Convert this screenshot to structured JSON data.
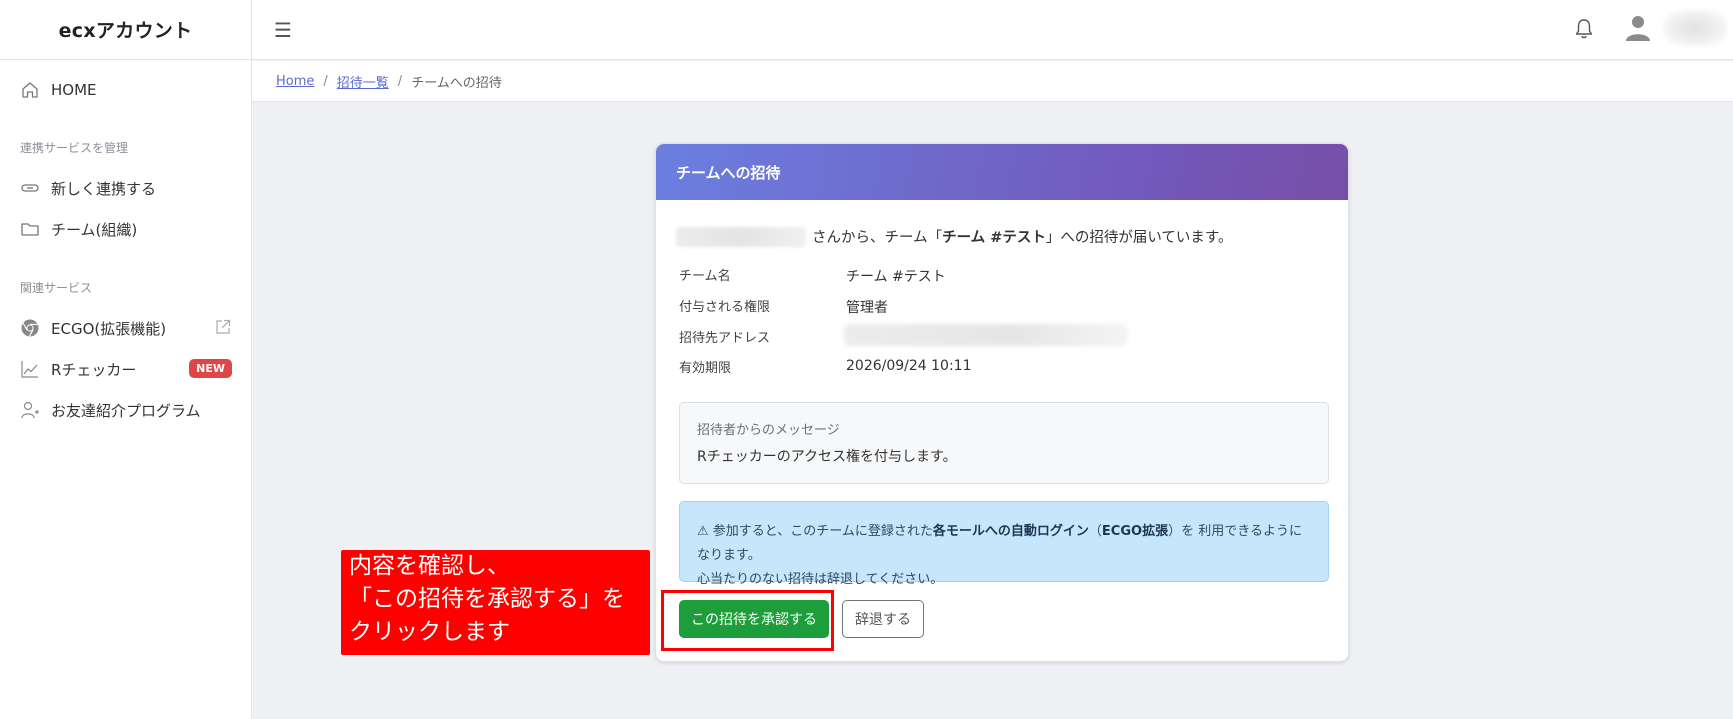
{
  "app": {
    "logo": "ecxアカウント"
  },
  "sidebar": {
    "home_label": "HOME",
    "section_manage": "連携サービスを管理",
    "new_link_label": "新しく連携する",
    "team_label": "チーム(組織)",
    "section_related": "関連サービス",
    "ecgo_label": "ECGO(拡張機能)",
    "rchecker_label": "Rチェッカー",
    "rchecker_badge": "NEW",
    "referral_label": "お友達紹介プログラム"
  },
  "topbar": {
    "menu_glyph": "☰"
  },
  "breadcrumb": {
    "home": "Home",
    "invite_list": "招待一覧",
    "current": "チームへの招待",
    "separator": "/"
  },
  "card": {
    "title": "チームへの招待",
    "intro_prefix": "さんから、チーム「",
    "intro_team": "チーム #テスト",
    "intro_suffix": "」への招待が届いています。",
    "details": [
      {
        "label": "チーム名",
        "value": "チーム #テスト"
      },
      {
        "label": "付与される権限",
        "value": "管理者"
      },
      {
        "label": "招待先アドレス",
        "value": ""
      },
      {
        "label": "有効期限",
        "value": "2026/09/24 10:11"
      }
    ],
    "message_label": "招待者からのメッセージ",
    "message_text": "Rチェッカーのアクセス権を付与します。",
    "info_icon": "⚠",
    "info_line1_pre": "参加すると、このチームに登録された",
    "info_line1_bold": "各モールへの自動ログイン",
    "info_line1_paren_open": "（",
    "info_line1_bold2": "ECGO拡張",
    "info_line1_paren_close": "）",
    "info_line1_post": "を 利用できるようになります。",
    "info_line2": "心当たりのない招待は辞退してください。",
    "approve_label": "この招待を承認する",
    "decline_label": "辞退する"
  },
  "annotation": {
    "lines": [
      "内容を確認し、",
      "「この招待を承認する」を",
      "クリックします"
    ]
  }
}
